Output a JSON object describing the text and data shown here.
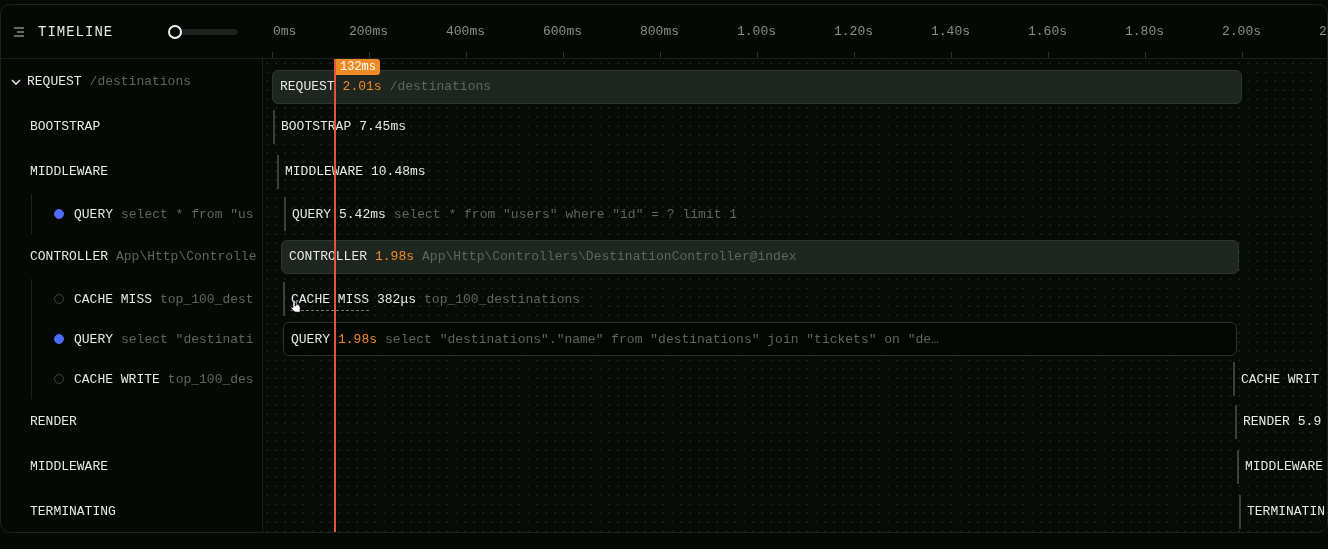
{
  "header": {
    "title": "TIMELINE",
    "zoom": {
      "level": 0
    },
    "ticks": [
      "0ms",
      "200ms",
      "400ms",
      "600ms",
      "800ms",
      "1.00s",
      "1.20s",
      "1.40s",
      "1.60s",
      "1.80s",
      "2.00s",
      "2"
    ]
  },
  "tree": {
    "name": "REQUEST",
    "detail": "/destinations",
    "expanded": true,
    "children": [
      {
        "name": "BOOTSTRAP"
      },
      {
        "name": "MIDDLEWARE",
        "children": [
          {
            "name": "QUERY",
            "detail": "select * from \"us",
            "kind": "query"
          }
        ]
      },
      {
        "name": "CONTROLLER",
        "detail": "App\\Http\\Controlle",
        "children": [
          {
            "name": "CACHE MISS",
            "detail": "top_100_dest",
            "kind": "cache"
          },
          {
            "name": "QUERY",
            "detail": "select \"destinati",
            "kind": "query"
          },
          {
            "name": "CACHE WRITE",
            "detail": "top_100_des",
            "kind": "cache"
          }
        ]
      },
      {
        "name": "RENDER"
      },
      {
        "name": "MIDDLEWARE"
      },
      {
        "name": "TERMINATING"
      }
    ]
  },
  "spans": [
    {
      "kind": "filled",
      "name": "REQUEST",
      "duration": "2.01s",
      "slow": true,
      "detail": "/destinations",
      "hovered": false
    },
    {
      "kind": "marker",
      "name": "BOOTSTRAP",
      "duration": "7.45ms",
      "slow": false,
      "hovered": false
    },
    {
      "kind": "marker",
      "name": "MIDDLEWARE",
      "duration": "10.48ms",
      "slow": false,
      "hovered": false
    },
    {
      "kind": "marker",
      "name": "QUERY",
      "duration": "5.42ms",
      "slow": false,
      "detail": "select * from \"users\" where \"id\" = ? limit 1",
      "hovered": false
    },
    {
      "kind": "filled",
      "name": "CONTROLLER",
      "duration": "1.98s",
      "slow": true,
      "detail": "App\\Http\\Controllers\\DestinationController@index",
      "hovered": false
    },
    {
      "kind": "marker",
      "name": "CACHE MISS",
      "duration": "382μs",
      "slow": false,
      "detail": "top_100_destinations",
      "hovered": true
    },
    {
      "kind": "outlined",
      "name": "QUERY",
      "duration": "1.98s",
      "slow": true,
      "detail": "select \"destinations\".\"name\" from \"destinations\" join \"tickets\" on \"de…",
      "hovered": false
    },
    {
      "kind": "marker",
      "name": "CACHE WRIT",
      "hovered": false
    },
    {
      "kind": "marker",
      "name": "RENDER",
      "duration": "5.9",
      "slow": false,
      "hovered": false
    },
    {
      "kind": "marker",
      "name": "MIDDLEWARE",
      "hovered": false
    },
    {
      "kind": "marker",
      "name": "TERMINATIN",
      "hovered": false
    }
  ],
  "cursor": {
    "label": "132ms"
  }
}
